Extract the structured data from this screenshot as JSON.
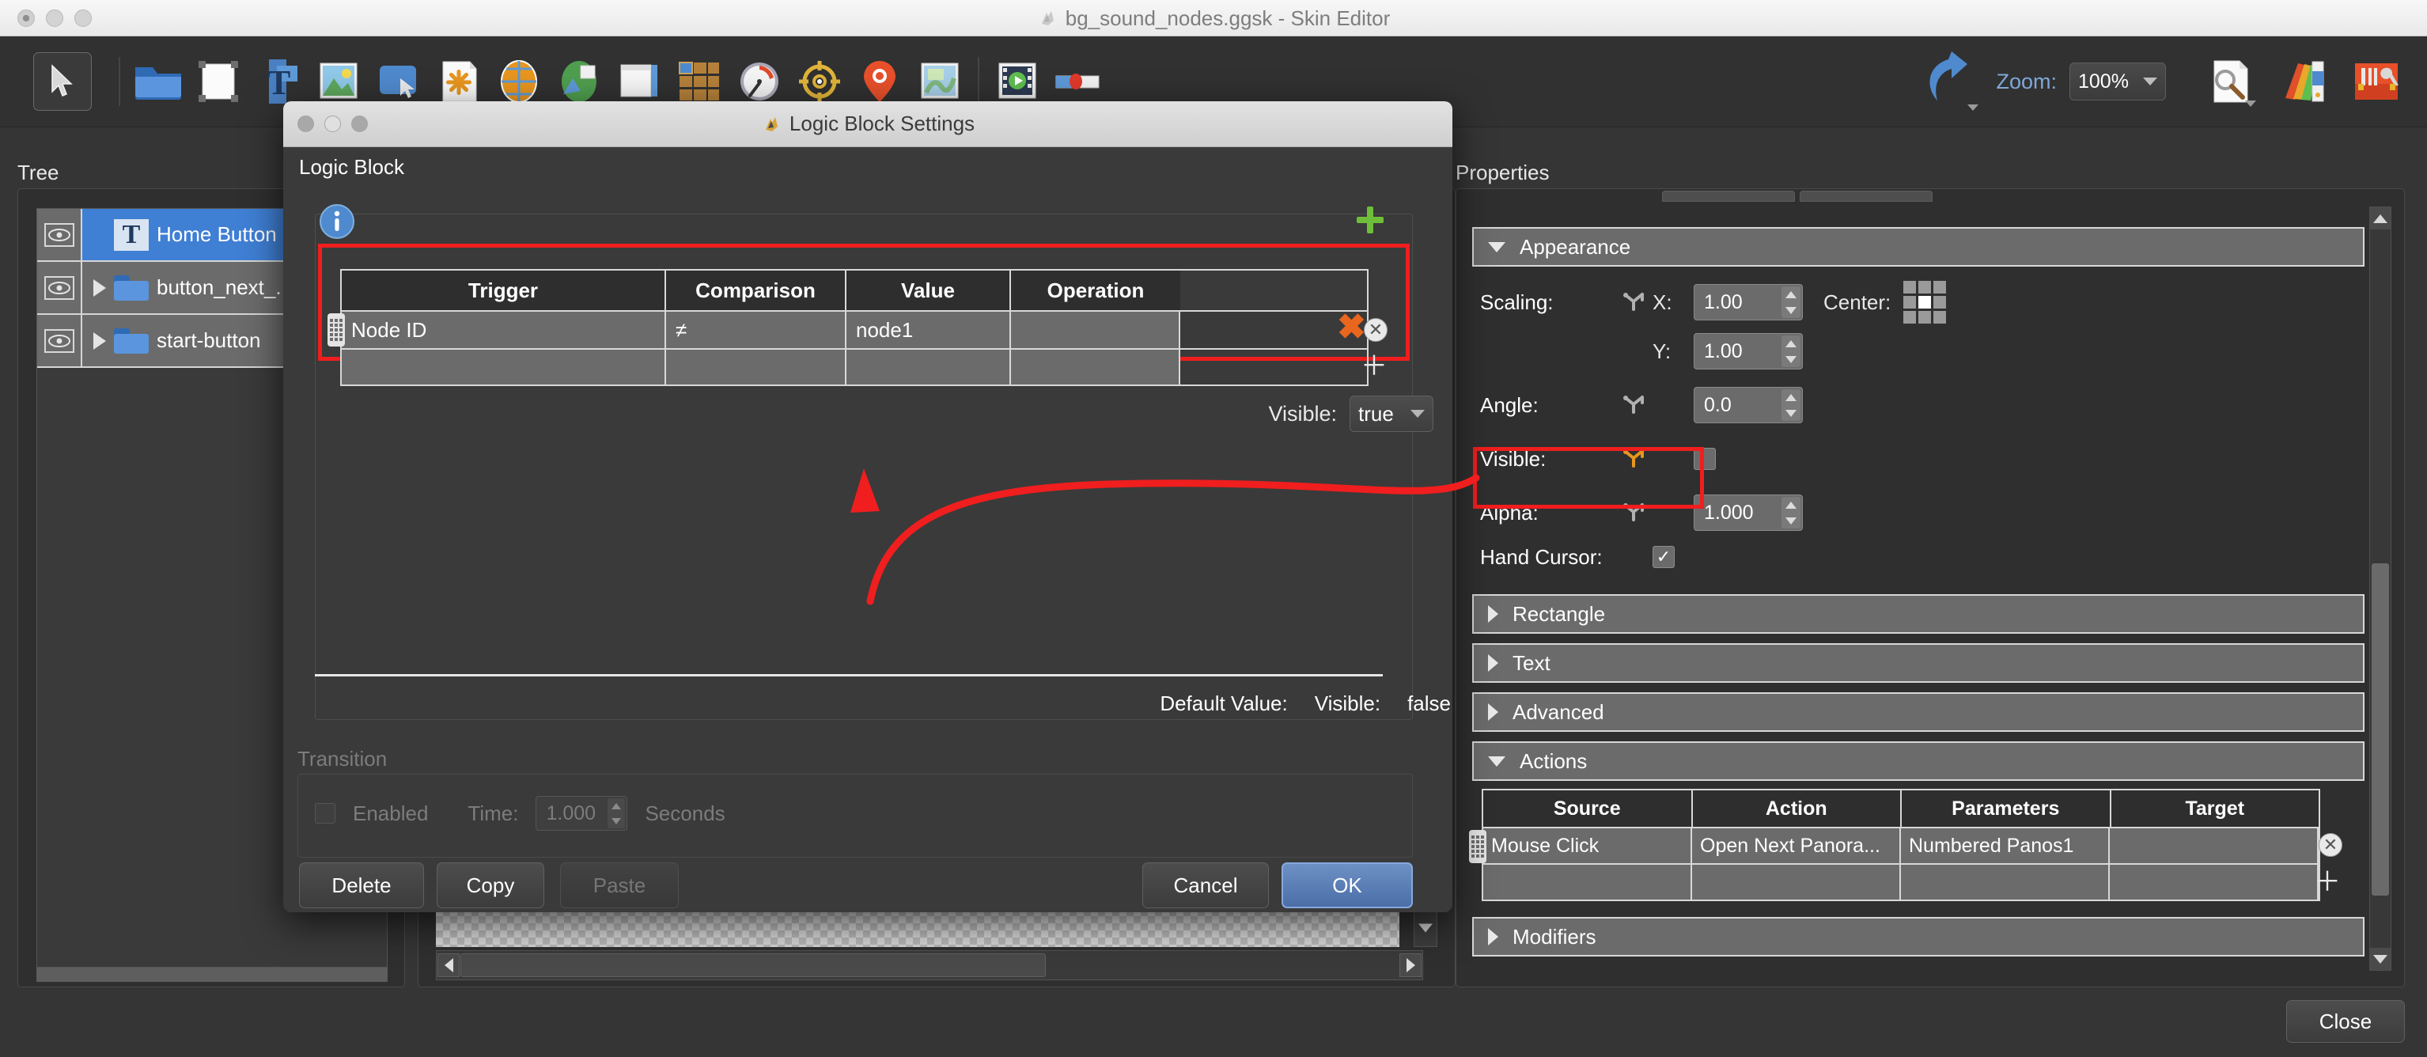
{
  "window": {
    "title": "bg_sound_nodes.ggsk - Skin Editor",
    "app_icon": "ggsk-app-icon"
  },
  "toolbar": {
    "zoom_label": "Zoom:",
    "zoom_value": "100%",
    "items": [
      {
        "name": "select-tool",
        "icon": "cursor-arrow-icon"
      },
      {
        "name": "open-folder",
        "icon": "folder-icon"
      },
      {
        "name": "new-container",
        "icon": "white-page-icon"
      },
      {
        "name": "add-text",
        "icon": "text-t-icon"
      },
      {
        "name": "add-image",
        "icon": "image-icon"
      },
      {
        "name": "add-button",
        "icon": "button-icon"
      },
      {
        "name": "add-hotspot",
        "icon": "hotspot-flower-icon"
      },
      {
        "name": "add-map",
        "icon": "globe-icon"
      },
      {
        "name": "add-world-map",
        "icon": "world-icon"
      },
      {
        "name": "add-popup",
        "icon": "window-icon"
      },
      {
        "name": "add-thumbnails",
        "icon": "grid-thumbs-icon"
      },
      {
        "name": "add-compass-gauge",
        "icon": "gauge-icon"
      },
      {
        "name": "add-compass",
        "icon": "compass-icon"
      },
      {
        "name": "add-marker",
        "icon": "map-pin-icon"
      },
      {
        "name": "add-floorplan",
        "icon": "floorplan-icon"
      },
      {
        "name": "add-video",
        "icon": "video-play-icon"
      },
      {
        "name": "add-slider",
        "icon": "slider-icon"
      },
      {
        "name": "undo",
        "icon": "undo-arrow-icon"
      },
      {
        "name": "preview",
        "icon": "page-magnifier-icon"
      },
      {
        "name": "color-palette",
        "icon": "palette-icon"
      },
      {
        "name": "tools",
        "icon": "toolbox-icon"
      }
    ]
  },
  "tree": {
    "title": "Tree",
    "rows": [
      {
        "label": "Home Button",
        "icon": "text-t-icon",
        "selected": true,
        "expandable": false
      },
      {
        "label": "button_next_...",
        "icon": "folder-icon",
        "selected": false,
        "expandable": true
      },
      {
        "label": "start-button",
        "icon": "folder-icon",
        "selected": false,
        "expandable": true
      }
    ]
  },
  "properties": {
    "title": "Properties",
    "appearance": {
      "header": "Appearance",
      "scaling_label": "Scaling:",
      "x_label": "X:",
      "x_value": "1.00",
      "y_label": "Y:",
      "y_value": "1.00",
      "center_label": "Center:",
      "angle_label": "Angle:",
      "angle_value": "0.0",
      "visible_label": "Visible:",
      "alpha_label": "Alpha:",
      "alpha_value": "1.000",
      "hand_cursor_label": "Hand Cursor:",
      "hand_cursor_checked": "✓"
    },
    "sections": [
      {
        "header": "Rectangle",
        "expanded": false
      },
      {
        "header": "Text",
        "expanded": false
      },
      {
        "header": "Advanced",
        "expanded": false
      },
      {
        "header": "Actions",
        "expanded": true
      },
      {
        "header": "Modifiers",
        "expanded": false
      }
    ],
    "actions_table": {
      "columns": [
        "Source",
        "Action",
        "Parameters",
        "Target"
      ],
      "rows": [
        {
          "source": "Mouse Click",
          "action": "Open Next Panora...",
          "parameters": "Numbered Panos1",
          "target": ""
        },
        {
          "source": "",
          "action": "",
          "parameters": "",
          "target": ""
        }
      ],
      "remove_icon": "remove-circle-icon",
      "add_icon": "plus-icon"
    }
  },
  "dialog": {
    "title": "Logic Block Settings",
    "section_label": "Logic Block",
    "info_icon": "info-icon",
    "add_icon": "green-plus-icon",
    "delete_row_icon": "orange-x-icon",
    "table": {
      "columns": [
        "Trigger",
        "Comparison",
        "Value",
        "Operation"
      ],
      "rows": [
        {
          "trigger": "Node ID",
          "comparison": "≠",
          "value": "node1",
          "operation": ""
        },
        {
          "trigger": "",
          "comparison": "",
          "value": "",
          "operation": ""
        }
      ]
    },
    "visible_label": "Visible:",
    "visible_value": "true",
    "default_value_label": "Default Value:",
    "default_visible_label": "Visible:",
    "default_visible_value": "false",
    "transition": {
      "label": "Transition",
      "enabled_label": "Enabled",
      "time_label": "Time:",
      "time_value": "1.000",
      "seconds_label": "Seconds"
    },
    "buttons": {
      "delete": "Delete",
      "copy": "Copy",
      "paste": "Paste",
      "cancel": "Cancel",
      "ok": "OK"
    }
  },
  "footer": {
    "close_label": "Close"
  },
  "colors": {
    "background": "#353535",
    "panel": "#2f2f2f",
    "row": "#6b6b6b",
    "selection_blue": "#3f7fd4",
    "annotation_red": "#f01e1e",
    "accent_orange": "#e8961e",
    "link_blue": "#7fa8d8"
  }
}
